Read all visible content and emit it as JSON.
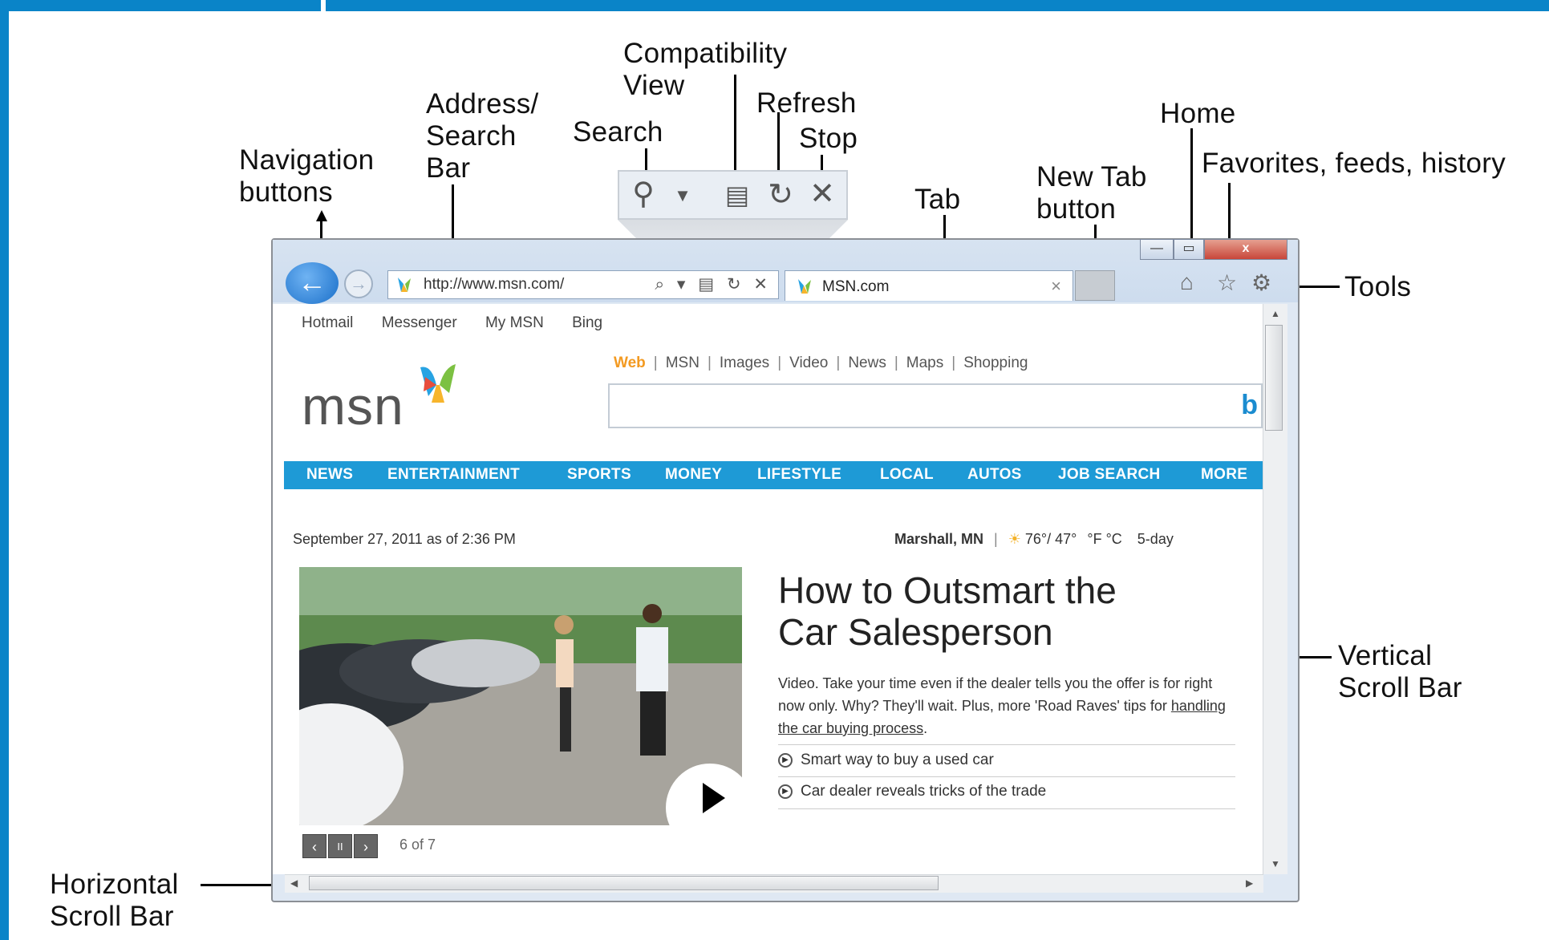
{
  "callouts": {
    "compatibility": "Compatibility\nView",
    "refresh": "Refresh",
    "address": "Address/\nSearch\nBar",
    "search": "Search",
    "stop": "Stop",
    "home": "Home",
    "navigation": "Navigation\nbuttons",
    "new_tab": "New Tab\nbutton",
    "tab": "Tab",
    "favorites": "Favorites, feeds, history",
    "tools": "Tools",
    "vertical_scroll": "Vertical\nScroll Bar",
    "horizontal_scroll": "Horizontal\nScroll Bar"
  },
  "zoom_toolbar": {
    "icons": [
      "search-icon",
      "dropdown-arrow-icon",
      "compatibility-view-icon",
      "refresh-icon",
      "stop-icon"
    ]
  },
  "browser": {
    "address_url": "http://www.msn.com/",
    "address_icons": "⌕ ▾ ▤ ↻ ✕",
    "tab_title": "MSN.com",
    "tab_close": "×",
    "window_buttons": {
      "minimize": "—",
      "maximize": "▭",
      "close": "x"
    }
  },
  "page": {
    "top_links": [
      "Hotmail",
      "Messenger",
      "My MSN",
      "Bing"
    ],
    "search_tabs": [
      "Web",
      "MSN",
      "Images",
      "Video",
      "News",
      "Maps",
      "Shopping"
    ],
    "logo": "msn",
    "bing_mark": "b",
    "nav_items": [
      "NEWS",
      "ENTERTAINMENT",
      "SPORTS",
      "MONEY",
      "LIFESTYLE",
      "LOCAL",
      "AUTOS",
      "JOB SEARCH",
      "MORE"
    ],
    "date": "September 27, 2011 as of 2:36 PM",
    "weather": {
      "location": "Marshall, MN",
      "temps": "76°/ 47°",
      "units": "°F °C",
      "forecast": "5-day"
    },
    "headline": "How to Outsmart the\nCar Salesperson",
    "description_pre": "Video. Take your time even if the dealer tells you the offer is for right now only. Why? They'll wait. Plus, more 'Road Raves' tips for ",
    "description_link": "handling the car buying process",
    "description_post": ".",
    "related": [
      "Smart way to buy a used car",
      "Car dealer reveals tricks of the trade"
    ],
    "slideshow": {
      "prev": "‹",
      "pause": "II",
      "next": "›",
      "counter": "6 of 7"
    }
  },
  "colors": {
    "frame": "#0a84c8",
    "nav_bar": "#1e9ad6",
    "web_tab": "#f39a21"
  }
}
